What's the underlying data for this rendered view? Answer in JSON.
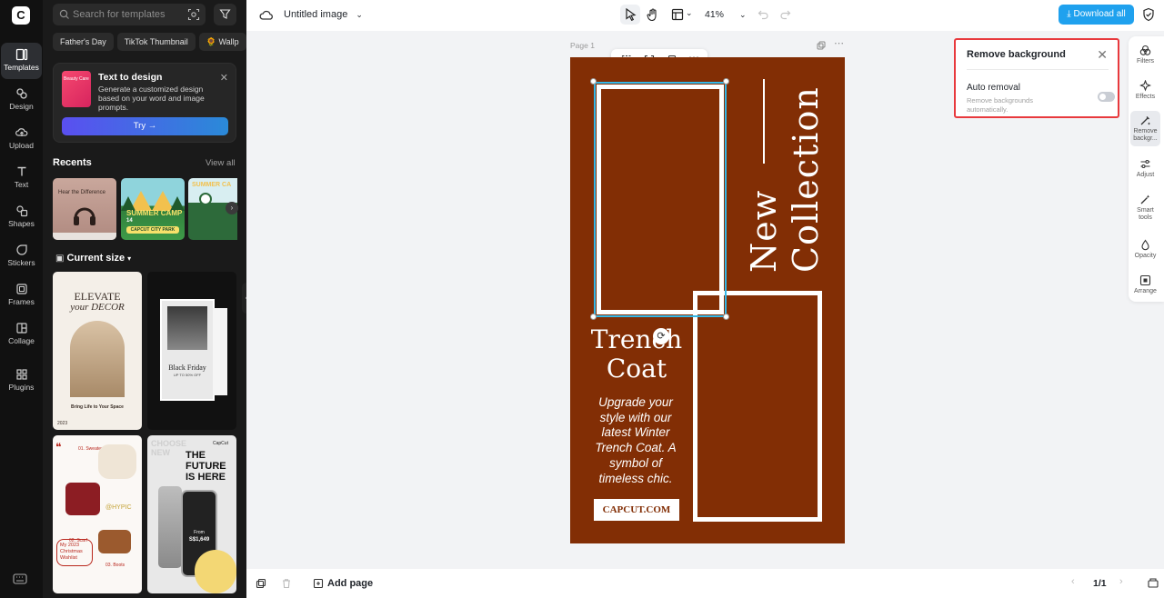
{
  "app": {
    "logo_letter": "C"
  },
  "rail": {
    "items": [
      {
        "label": "Templates"
      },
      {
        "label": "Design"
      },
      {
        "label": "Upload"
      },
      {
        "label": "Text"
      },
      {
        "label": "Shapes"
      },
      {
        "label": "Stickers"
      },
      {
        "label": "Frames"
      },
      {
        "label": "Collage"
      },
      {
        "label": "Plugins"
      }
    ]
  },
  "panel": {
    "search_placeholder": "Search for templates",
    "chips": [
      "Father's Day",
      "TikTok Thumbnail",
      "🌻 Wallp"
    ],
    "promo": {
      "title": "Text to design",
      "desc": "Generate a customized design based on your word and image prompts.",
      "thumb_text": "Beauty Care",
      "try": "Try →"
    },
    "recents_title": "Recents",
    "view_all": "View all",
    "recents": [
      {
        "text": "Hear the Difference"
      },
      {
        "text": "SUMMER CAMP",
        "sub": "CAPCUT CITY PARK",
        "num": "14"
      },
      {
        "text": "SUMMER CA"
      }
    ],
    "current_size": "Current size",
    "templates": [
      {
        "t1": "ELEVATE",
        "t2": "your DECOR",
        "t3": "Bring Life to Your Space",
        "t4": "2023"
      },
      {
        "t1": "Black Friday",
        "t2": "UP TO 50% OFF"
      },
      {
        "t1": "@HYPIC",
        "t2": "My 2023 Christmas Wishlist",
        "t3": "01. Sweater",
        "t4": "02. Scarf",
        "t5": "03. Boots"
      },
      {
        "t1": "THE FUTURE IS HERE",
        "t2": "From",
        "t3": "S$1,649",
        "t4": "CapCut",
        "t5": "CHOOSE NEW"
      }
    ]
  },
  "topbar": {
    "doc_title": "Untitled image",
    "zoom": "41%",
    "download": "Download all"
  },
  "canvas": {
    "page_label": "Page 1",
    "design": {
      "vertical_title": "New Collection",
      "title_line1": "Trench",
      "title_line2": "Coat",
      "body": "Upgrade your style with our latest Winter Trench Coat. A symbol of timeless chic.",
      "site": "CAPCUT.COM",
      "bg_color": "#822e05"
    }
  },
  "remove_bg": {
    "title": "Remove background",
    "auto_removal": "Auto removal",
    "auto_desc": "Remove backgrounds automatically.",
    "toggle_on": false
  },
  "right_tools": [
    {
      "label": "Filters"
    },
    {
      "label": "Effects"
    },
    {
      "label": "Remove backgr..."
    },
    {
      "label": "Adjust"
    },
    {
      "label": "Smart tools"
    },
    {
      "label": "Opacity"
    },
    {
      "label": "Arrange"
    }
  ],
  "bottombar": {
    "add_page": "Add page",
    "page_count": "1/1"
  }
}
